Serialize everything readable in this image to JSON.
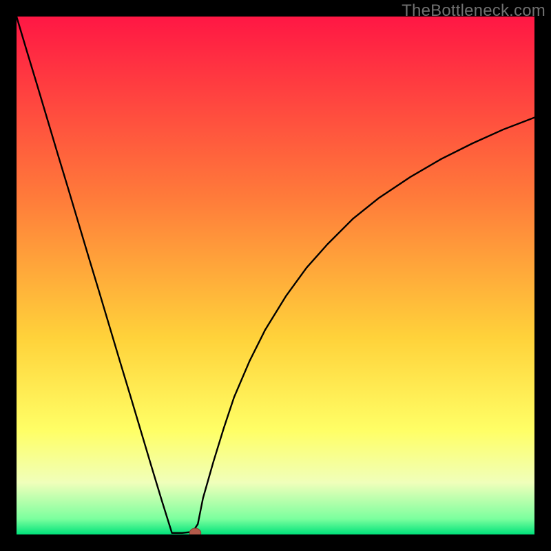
{
  "watermark": "TheBottleneck.com",
  "chart_data": {
    "type": "line",
    "title": "",
    "xlabel": "",
    "ylabel": "",
    "xlim": [
      0,
      100
    ],
    "ylim": [
      0,
      100
    ],
    "grid": false,
    "legend": false,
    "annotations": [],
    "background_gradient_stops": [
      {
        "pct": 0,
        "color": "#ff1744"
      },
      {
        "pct": 35,
        "color": "#ff7b3a"
      },
      {
        "pct": 62,
        "color": "#ffd23a"
      },
      {
        "pct": 80,
        "color": "#ffff66"
      },
      {
        "pct": 90,
        "color": "#f0ffba"
      },
      {
        "pct": 97,
        "color": "#7bff9e"
      },
      {
        "pct": 100,
        "color": "#00e27a"
      }
    ],
    "series": [
      {
        "name": "bottleneck-curve",
        "color": "#000000",
        "stroke_width": 2.4,
        "x": [
          0,
          2,
          4,
          6,
          8,
          10,
          12,
          14,
          16,
          18,
          20,
          22,
          24,
          26,
          28,
          30,
          30.5,
          32,
          34,
          35,
          36,
          38,
          40,
          42,
          45,
          48,
          52,
          56,
          60,
          65,
          70,
          76,
          82,
          88,
          94,
          100
        ],
        "y": [
          100,
          93.3,
          86.7,
          80.0,
          73.3,
          66.7,
          60.0,
          53.3,
          46.7,
          40.0,
          33.3,
          26.7,
          20.0,
          13.3,
          6.7,
          0.3,
          0.3,
          0.3,
          0.5,
          2.0,
          7.0,
          14.0,
          20.5,
          26.5,
          33.5,
          39.5,
          46.0,
          51.5,
          56.0,
          61.0,
          65.0,
          69.0,
          72.5,
          75.5,
          78.2,
          80.5
        ]
      }
    ],
    "marker": {
      "name": "optimal-point",
      "x": 34.5,
      "y": 0.3,
      "rx": 1.1,
      "ry": 0.9,
      "fill": "#b35a4a",
      "stroke": "#8a3c30"
    }
  }
}
